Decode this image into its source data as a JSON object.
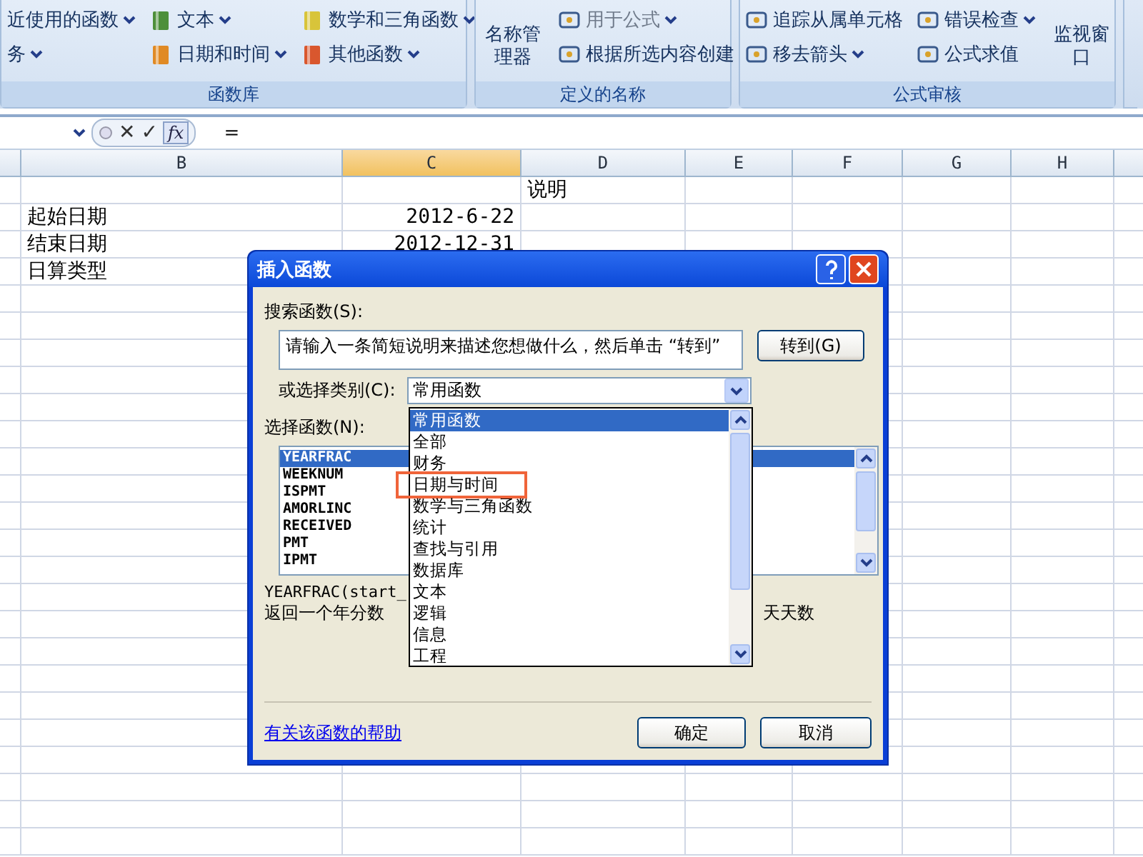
{
  "ribbon": {
    "groups": [
      {
        "label": "函数库",
        "items": [
          {
            "kind": "text-only",
            "label": "近使用的函数",
            "dropdown": true,
            "disabled": false
          },
          {
            "kind": "text-only",
            "label": "务",
            "dropdown": true,
            "disabled": false
          },
          {
            "kind": "small",
            "label": "文本",
            "dropdown": true,
            "disabled": false
          },
          {
            "kind": "small",
            "label": "日期和时间",
            "dropdown": true,
            "disabled": false
          },
          {
            "kind": "small",
            "label": "数学和三角函数",
            "dropdown": true,
            "disabled": false
          },
          {
            "kind": "small",
            "label": "其他函数",
            "dropdown": true,
            "disabled": false
          }
        ]
      },
      {
        "label": "定义的名称",
        "items": [
          {
            "kind": "large",
            "label": "名称管理器",
            "dropdown": false,
            "disabled": false
          },
          {
            "kind": "small",
            "label": "用于公式",
            "dropdown": true,
            "disabled": true
          },
          {
            "kind": "small",
            "label": "根据所选内容创建",
            "dropdown": false,
            "disabled": false
          }
        ]
      },
      {
        "label": "公式审核",
        "items": [
          {
            "kind": "small",
            "label": "追踪从属单元格",
            "dropdown": false,
            "disabled": false
          },
          {
            "kind": "small",
            "label": "移去箭头",
            "dropdown": true,
            "disabled": false
          },
          {
            "kind": "small",
            "label": "错误检查",
            "dropdown": true,
            "disabled": false
          },
          {
            "kind": "small",
            "label": "公式求值",
            "dropdown": false,
            "disabled": false
          },
          {
            "kind": "large",
            "label": "监视窗口",
            "dropdown": false,
            "disabled": false
          }
        ]
      }
    ]
  },
  "formula_bar": {
    "cancel": "✕",
    "enter": "✓",
    "fx": "fx",
    "value": "="
  },
  "sheet": {
    "columns": [
      {
        "label": "B",
        "selected": false
      },
      {
        "label": "C",
        "selected": true
      },
      {
        "label": "D",
        "selected": false
      },
      {
        "label": "E",
        "selected": false
      },
      {
        "label": "F",
        "selected": false
      },
      {
        "label": "G",
        "selected": false
      },
      {
        "label": "H",
        "selected": false
      }
    ],
    "rows": [
      {
        "cells": [
          {
            "kind": "empty"
          },
          {
            "kind": "empty"
          },
          {
            "kind": "text",
            "text": "说明"
          }
        ]
      },
      {
        "cells": [
          {
            "kind": "text",
            "text": "起始日期"
          },
          {
            "kind": "date",
            "text": "2012-6-22"
          }
        ]
      },
      {
        "cells": [
          {
            "kind": "text",
            "text": "结束日期"
          },
          {
            "kind": "date",
            "text": "2012-12-31"
          }
        ]
      },
      {
        "cells": [
          {
            "kind": "text",
            "text": "日算类型"
          }
        ]
      }
    ]
  },
  "dialog": {
    "title": "插入函数",
    "search_label": "搜索函数(S):",
    "search_value": "请输入一条简短说明来描述您想做什么，然后单击 “转到”",
    "go_button": "转到(G)",
    "category_label": "或选择类别(C):",
    "category_value": "常用函数",
    "category_options": [
      {
        "label": "常用函数",
        "selected": true,
        "highlighted": false
      },
      {
        "label": "全部",
        "selected": false,
        "highlighted": false
      },
      {
        "label": "财务",
        "selected": false,
        "highlighted": false
      },
      {
        "label": "日期与时间",
        "selected": false,
        "highlighted": true
      },
      {
        "label": "数学与三角函数",
        "selected": false,
        "highlighted": false
      },
      {
        "label": "统计",
        "selected": false,
        "highlighted": false
      },
      {
        "label": "查找与引用",
        "selected": false,
        "highlighted": false
      },
      {
        "label": "数据库",
        "selected": false,
        "highlighted": false
      },
      {
        "label": "文本",
        "selected": false,
        "highlighted": false
      },
      {
        "label": "逻辑",
        "selected": false,
        "highlighted": false
      },
      {
        "label": "信息",
        "selected": false,
        "highlighted": false
      },
      {
        "label": "工程",
        "selected": false,
        "highlighted": false
      }
    ],
    "function_label": "选择函数(N):",
    "functions": [
      {
        "label": "YEARFRAC",
        "selected": true
      },
      {
        "label": "WEEKNUM",
        "selected": false
      },
      {
        "label": "ISPMT",
        "selected": false
      },
      {
        "label": "AMORLINC",
        "selected": false
      },
      {
        "label": "RECEIVED",
        "selected": false
      },
      {
        "label": "PMT",
        "selected": false
      },
      {
        "label": "IPMT",
        "selected": false
      }
    ],
    "syntax": "YEARFRAC(start_",
    "description_left": "返回一个年分数",
    "description_right": "天天数",
    "help_link": "有关该函数的帮助",
    "ok_button": "确定",
    "cancel_button": "取消"
  }
}
